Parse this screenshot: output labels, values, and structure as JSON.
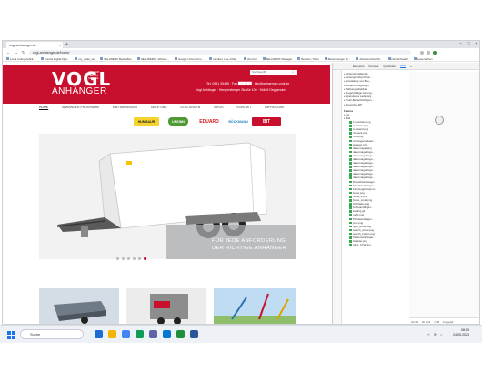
{
  "browser": {
    "tab_title": "vogl-anhaenger.de",
    "tab_close": "×",
    "new_tab": "+",
    "window_controls": [
      "–",
      "□",
      "×"
    ],
    "url": "vogl-anhaenger.de/home/",
    "bookmarks": [
      "Local Listing Aufträ...",
      "Trends Digital Opti...",
      "my_mails_sw",
      "SELLWERK Backoffice",
      "SELLWERK - Wissen...",
      "Google Unternehm...",
      "member. Live-Chat...",
      "Vosi Kai",
      "SELLWERK Manager",
      "Boards | Trello",
      "Bewerbungen Di...",
      "Arbeitsnotizen Di...",
      "Neil Schwartz",
      "Lesezeichen"
    ]
  },
  "site": {
    "logo_main": "VOGL",
    "logo_small": [
      "VERKAUF",
      "VERLEIH",
      "SERVICE"
    ],
    "logo_sub": "ANHÄNGER",
    "search_placeholder": "Suchbegriff",
    "contact_line1": "Tel. 0991 39435 · Fax ██████ · info@anhaenger-vogl.de",
    "contact_line2": "Vogl Anhänger · Hengersberger Straße 100 · 94469 Deggendorf",
    "nav": [
      "HOME",
      "ANHÄNGER-PROGRAMM",
      "MIETANHÄNGER",
      "ÜBER UNS",
      "LEISTUNGEN",
      "INFOS",
      "KONTAKT",
      "IMPRESSUM"
    ],
    "brands": [
      "HUMBAUR",
      "UNSINN",
      "EDUARD",
      "BÖCKMANN",
      "BIT"
    ],
    "hero_caption_1": "FÜR JEDE ANFORDERUNG",
    "hero_caption_2": "DER RICHTIGE ANHÄNGER",
    "slider_count": 6,
    "slider_active": 5
  },
  "devtools": {
    "tabs": [
      "Elements",
      "Konsole",
      "Quellcode",
      "Netz",
      "»"
    ],
    "active_tab": "Netz",
    "tree": [
      "Hintergrunddienste",
      "Hintergrundsynchron...",
      "Einstellung von Bes...",
      "Benachrichtigungen",
      "Zahlungsabwickler",
      "Regelmäßiger Hinterg...",
      "Spekulative Ladevorg...",
      "Push-Benachrichtigun...",
      "Reporting API"
    ],
    "frames_title": "Frames",
    "frames": [
      "top",
      "Bild"
    ],
    "files": [
      "1-humbaur.png",
      "2-unsinn.png",
      "3-eduard.png",
      "4-boeck.png",
      "5-bit.png",
      "Anhängerverkauf...",
      "anlagen.png",
      "datenmagel.png",
      "datenmagel-logo...",
      "datenmagel-logo...",
      "datenmagel-logo...",
      "datenmagel-logo...",
      "datenmagel-logo...",
      "datenmagel-logo...",
      "datenmagel-logo...",
      "datenmagel-logo...",
      "Dreiachsanhänger...",
      "Einachsanhänger...",
      "Fahrzeugtransport...",
      "home.png",
      "home_2.png",
      "home_small.png",
      "hochlader.png",
      "Kofferanhänger...",
      "loading.gif",
      "mehr.png",
      "Pferdeanhänger...",
      "prev.png",
      "right_arrow.png",
      "search_arrow.png",
      "search_button.png",
      "Tandemanhänger...",
      "tieflader.png",
      "trans_LKW.png"
    ],
    "status": [
      "22×26",
      "26 × 24",
      "1 kB",
      "image/gif"
    ]
  },
  "taskbar": {
    "search_placeholder": "Suche",
    "time": "08:55",
    "date": "24.05.2023"
  },
  "colors": {
    "brand_red": "#c8102e",
    "active_dot": "#c8102e"
  }
}
